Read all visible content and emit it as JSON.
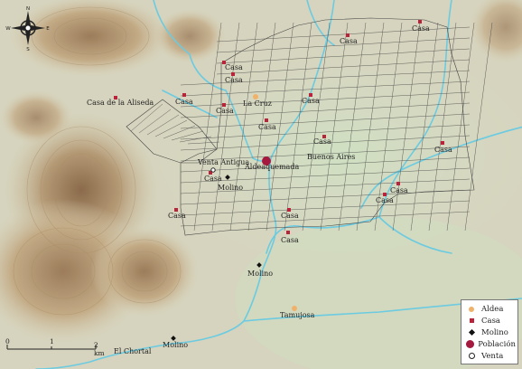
{
  "legend": {
    "aldea": "Aldea",
    "casa": "Casa",
    "molino": "Molino",
    "poblacion": "Población",
    "venta": "Venta"
  },
  "compass": {
    "n": "N",
    "s": "S",
    "e": "E",
    "w": "W"
  },
  "scale": {
    "start": "0",
    "mid": "1",
    "end": "2 km"
  },
  "places": {
    "casa_de_la_aliseda": "Casa de la Aliseda",
    "la_cruz": "La Cruz",
    "aldeaquemada": "Aldeaquemada",
    "buenos_aires": "Buenos Aires",
    "venta_antigua": "Venta Antigua",
    "tamujosa": "Tamujosa",
    "el_chortal": "El Chortal",
    "casa": "Casa",
    "molino": "Molino"
  },
  "colors": {
    "river": "#6ccbe0",
    "poblacion": "#a5193f",
    "casa": "#b8243a",
    "aldea": "#f0b26a",
    "grid": "#4a4a4a"
  }
}
